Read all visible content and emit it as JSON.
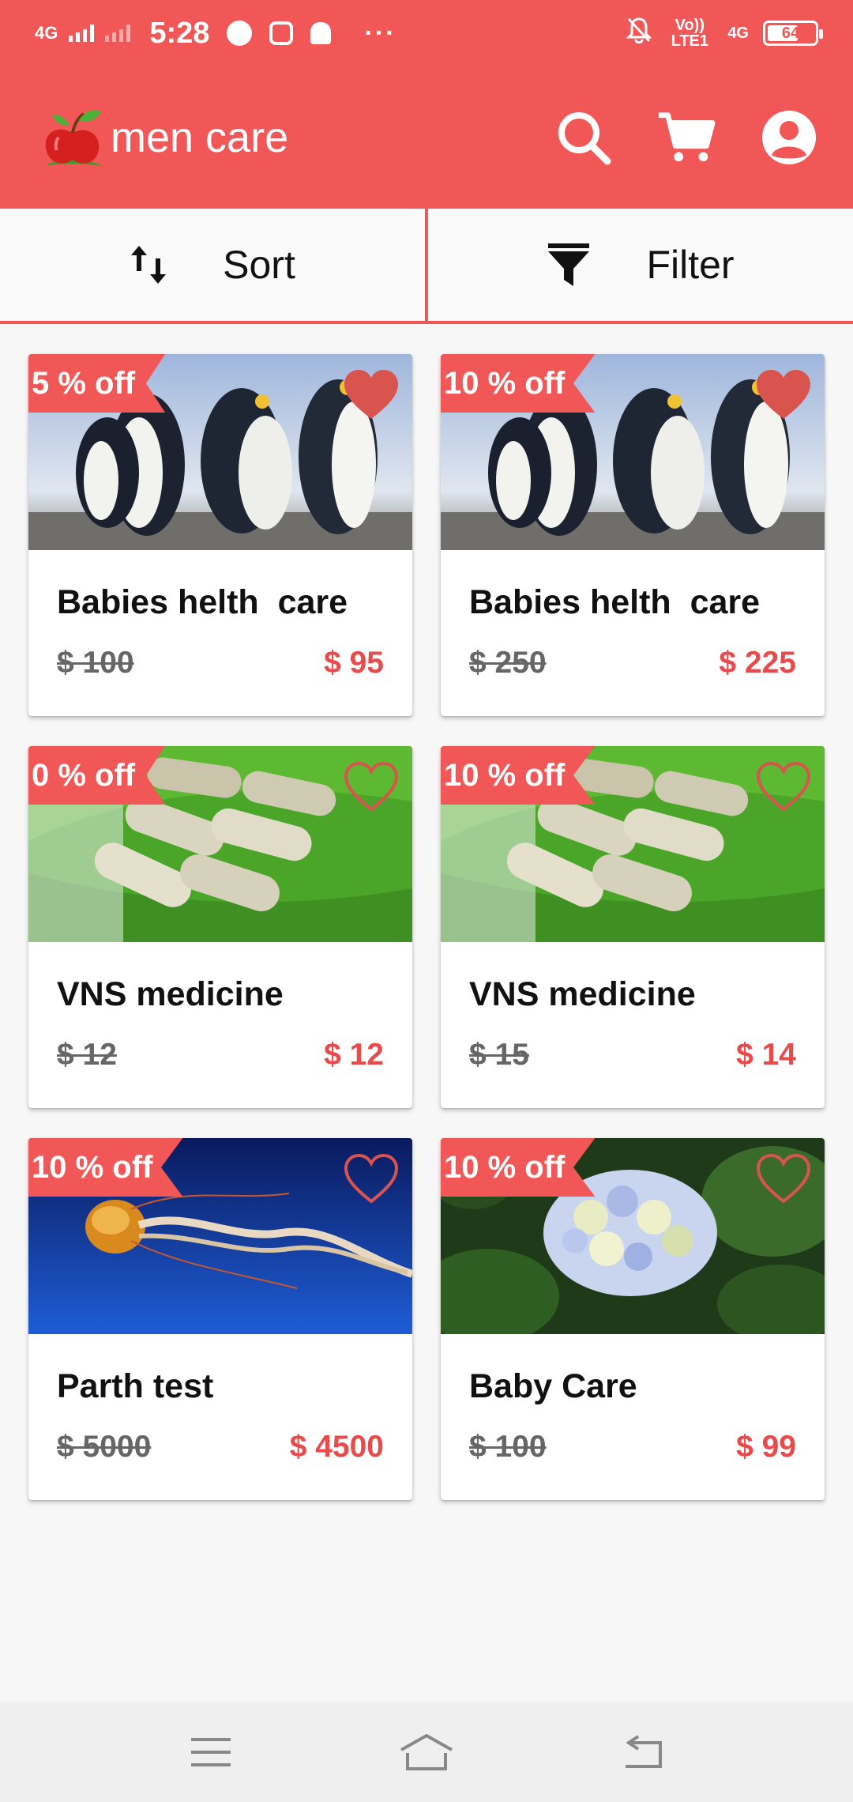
{
  "status_bar": {
    "network": "4G",
    "time": "5:28",
    "volte": "Vo)) LTE1",
    "network2": "4G",
    "battery": "64"
  },
  "app_bar": {
    "title": "men care",
    "icons": [
      "search-icon",
      "cart-icon",
      "account-icon"
    ]
  },
  "toolbar": {
    "sort_label": "Sort",
    "filter_label": "Filter"
  },
  "products": [
    {
      "discount": "5 % off",
      "title": "Babies helth  care",
      "old_price": "$ 100",
      "new_price": "$ 95",
      "favorite": true,
      "image": "penguins"
    },
    {
      "discount": "10 % off",
      "title": "Babies helth  care",
      "old_price": "$ 250",
      "new_price": "$ 225",
      "favorite": true,
      "image": "penguins"
    },
    {
      "discount": "0 % off",
      "title": "VNS medicine",
      "old_price": "$ 12",
      "new_price": "$ 12",
      "favorite": false,
      "image": "capsules"
    },
    {
      "discount": "10 % off",
      "title": "VNS medicine",
      "old_price": "$ 15",
      "new_price": "$ 14",
      "favorite": false,
      "image": "capsules"
    },
    {
      "discount": "10 % off",
      "title": "Parth test",
      "old_price": "$ 5000",
      "new_price": "$ 4500",
      "favorite": false,
      "image": "jellyfish"
    },
    {
      "discount": "10 % off",
      "title": "Baby Care",
      "old_price": "$ 100",
      "new_price": "$ 99",
      "favorite": false,
      "image": "hydrangea"
    }
  ],
  "colors": {
    "accent": "#f25757",
    "price_red": "#e84b4b",
    "heart": "#d9534f"
  },
  "nav_bar": {
    "icons": [
      "menu-icon",
      "home-icon",
      "back-icon"
    ]
  }
}
